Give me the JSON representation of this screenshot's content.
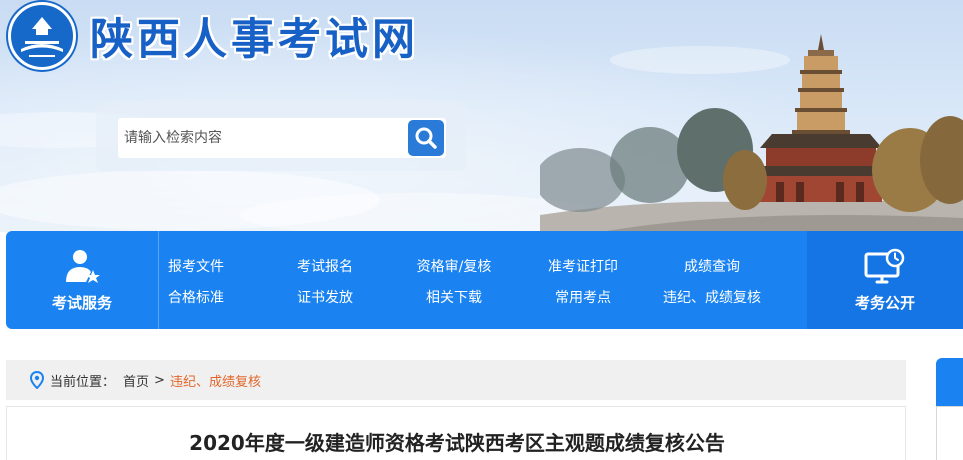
{
  "site": {
    "title": "陕西人事考试网"
  },
  "search": {
    "placeholder": "请输入检索内容",
    "value": ""
  },
  "nav": {
    "service_label": "考试服务",
    "open_label": "考务公开",
    "links": [
      {
        "label": "报考文件"
      },
      {
        "label": "考试报名"
      },
      {
        "label": "资格审/复核"
      },
      {
        "label": "准考证打印"
      },
      {
        "label": "成绩查询"
      },
      {
        "label": "合格标准"
      },
      {
        "label": "证书发放"
      },
      {
        "label": "相关下载"
      },
      {
        "label": "常用考点"
      },
      {
        "label": "违纪、成绩复核"
      }
    ]
  },
  "breadcrumb": {
    "prefix": "当前位置：",
    "home": "首页",
    "separator": ">",
    "current": "违纪、成绩复核"
  },
  "article": {
    "title": "2020年度一级建造师资格考试陕西考区主观题成绩复核公告"
  },
  "icons": {
    "logo": "emblem-icon",
    "search": "search-icon",
    "service": "user-star-icon",
    "open": "monitor-clock-icon",
    "location": "location-pin-icon"
  },
  "colors": {
    "brand_blue": "#1a83f1",
    "logo_blue": "#1660c6",
    "breadcrumb_current": "#e2662a"
  }
}
